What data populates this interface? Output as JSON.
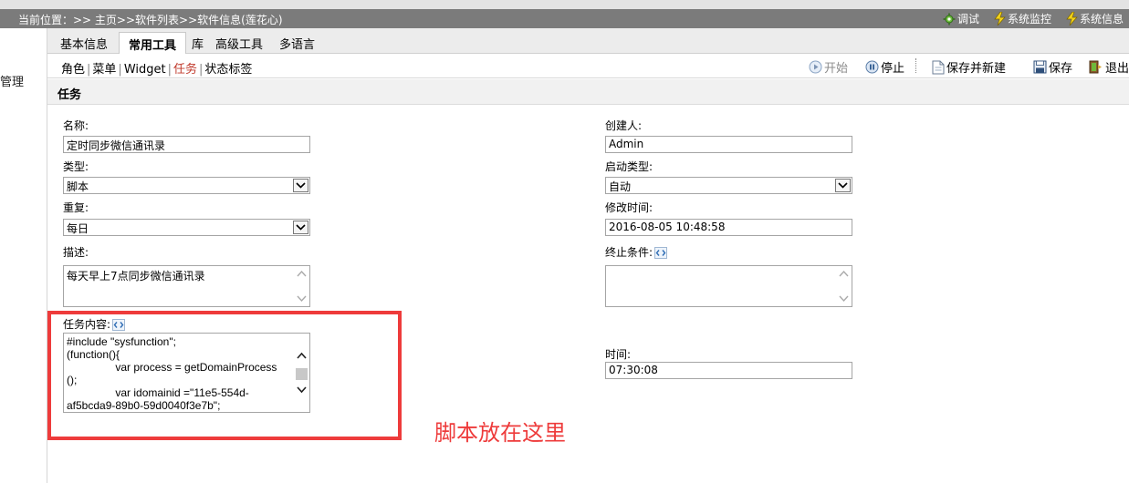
{
  "header": {
    "location": "当前位置：>> 主页>>软件列表>>软件信息(莲花心)",
    "actions": [
      {
        "label": "调试",
        "icon": "debug-gear-icon"
      },
      {
        "label": "系统监控",
        "icon": "lightning-icon"
      },
      {
        "label": "系统信息",
        "icon": "lightning-icon"
      }
    ]
  },
  "sidebar": {
    "item": "管理"
  },
  "tabs": [
    "基本信息",
    "常用工具",
    "库",
    "高级工具",
    "多语言"
  ],
  "active_tab": "常用工具",
  "subnav": {
    "links": [
      "角色",
      "菜单",
      "Widget",
      "任务",
      "状态标签"
    ],
    "current": "任务"
  },
  "toolbar": {
    "start": "开始",
    "stop": "停止",
    "save_new": "保存并新建",
    "save": "保存",
    "exit": "退出"
  },
  "section_title": "任务",
  "form": {
    "name_label": "名称:",
    "name_value": "定时同步微信通讯录",
    "type_label": "类型:",
    "type_value": "脚本",
    "repeat_label": "重复:",
    "repeat_value": "每日",
    "desc_label": "描述:",
    "desc_value": "每天早上7点同步微信通讯录",
    "content_label": "任务内容:",
    "content_value": "#include \"sysfunction\";\n(function(){\n                var process = getDomainProcess\n();\n                var idomainid =\"11e5-554d-\naf5bcda9-89b0-59d0040f3e7b\";",
    "creator_label": "创建人:",
    "creator_value": "Admin",
    "start_type_label": "启动类型:",
    "start_type_value": "自动",
    "modified_label": "修改时间:",
    "modified_value": "2016-08-05 10:48:58",
    "end_cond_label": "终止条件:",
    "end_cond_value": "",
    "time_label": "时间:",
    "time_value": "07:30:08"
  },
  "annotation": "脚本放在这里",
  "colors": {
    "annotation_red": "#ee3b3b",
    "current_link": "#c0392b",
    "titlebar": "#7b7b7b"
  }
}
